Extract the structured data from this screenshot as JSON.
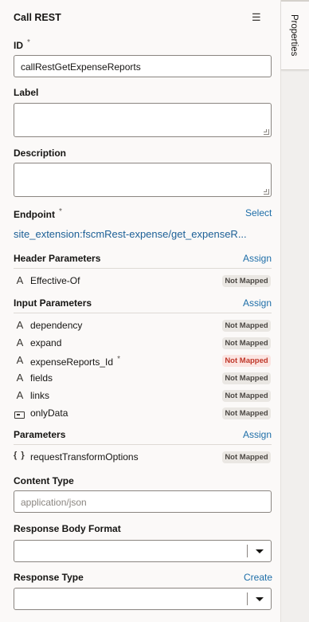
{
  "header": {
    "title": "Call REST",
    "menu_icon": "hamburger-icon"
  },
  "side_tab": {
    "label": "Properties"
  },
  "fields": {
    "id": {
      "label": "ID",
      "required_marker": "*",
      "value": "callRestGetExpenseReports"
    },
    "label": {
      "label": "Label",
      "value": ""
    },
    "description": {
      "label": "Description",
      "value": ""
    }
  },
  "endpoint": {
    "label": "Endpoint",
    "required_marker": "*",
    "action": "Select",
    "value": "site_extension:fscmRest-expense/get_expenseR..."
  },
  "header_parameters": {
    "label": "Header Parameters",
    "action": "Assign",
    "items": [
      {
        "name": "Effective-Of",
        "icon": "text-type-icon",
        "status": "Not Mapped"
      }
    ]
  },
  "input_parameters": {
    "label": "Input Parameters",
    "action": "Assign",
    "items": [
      {
        "name": "dependency",
        "icon": "text-type-icon",
        "status": "Not Mapped"
      },
      {
        "name": "expand",
        "icon": "text-type-icon",
        "status": "Not Mapped"
      },
      {
        "name": "expenseReports_Id",
        "icon": "text-type-icon",
        "required_marker": "*",
        "status": "Not Mapped"
      },
      {
        "name": "fields",
        "icon": "text-type-icon",
        "status": "Not Mapped"
      },
      {
        "name": "links",
        "icon": "text-type-icon",
        "status": "Not Mapped"
      },
      {
        "name": "onlyData",
        "icon": "boolean-type-icon",
        "status": "Not Mapped"
      }
    ]
  },
  "parameters": {
    "label": "Parameters",
    "action": "Assign",
    "items": [
      {
        "name": "requestTransformOptions",
        "icon": "object-type-icon",
        "glyph": "{ }",
        "status": "Not Mapped"
      }
    ]
  },
  "content_type": {
    "label": "Content Type",
    "placeholder": "application/json"
  },
  "response_body_format": {
    "label": "Response Body Format",
    "value": ""
  },
  "response_type": {
    "label": "Response Type",
    "action": "Create",
    "value": ""
  },
  "colors": {
    "link": "#1e6ea8",
    "badge_bg": "#eae7e3",
    "badge_required_bg": "#fbe4e1",
    "badge_required_text": "#c0392b"
  }
}
